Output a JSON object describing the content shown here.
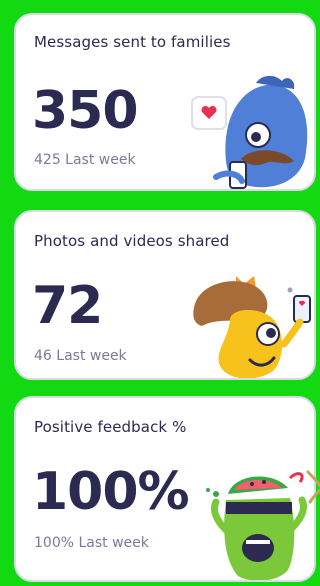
{
  "cards": [
    {
      "label": "Messages sent to families",
      "value": "350",
      "sub": "425 Last week",
      "mascot": "blue-bird-monster-icon"
    },
    {
      "label": "Photos and videos shared",
      "value": "72",
      "sub": "46 Last week",
      "mascot": "orange-bun-monster-icon"
    },
    {
      "label": "Positive feedback %",
      "value": "100%",
      "sub": "100% Last week",
      "mascot": "green-watermelon-monster-icon"
    }
  ],
  "colors": {
    "background": "#13d913",
    "text_primary": "#2c2a50",
    "text_secondary": "#7a7a9a",
    "card_border": "#d9d9e6"
  }
}
